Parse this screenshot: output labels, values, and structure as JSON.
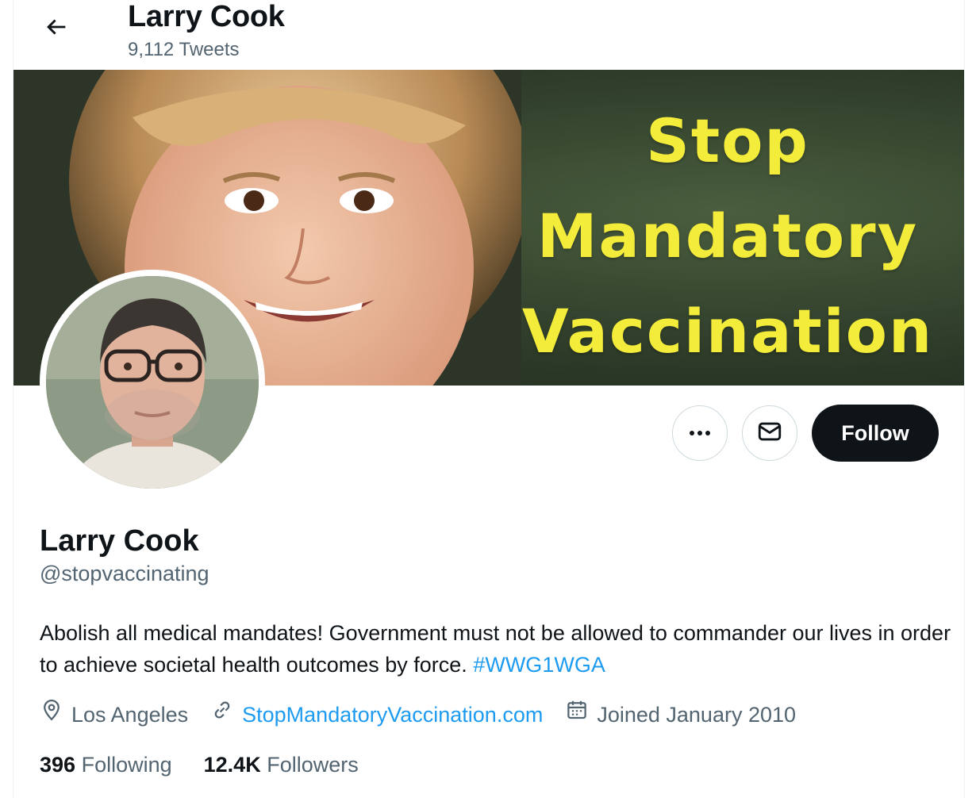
{
  "header": {
    "title": "Larry Cook",
    "tweet_count": "9,112 Tweets"
  },
  "banner": {
    "lines": [
      "Stop",
      "Mandatory",
      "Vaccination"
    ]
  },
  "actions": {
    "more_icon": "ellipsis-icon",
    "message_icon": "mail-icon",
    "follow_label": "Follow"
  },
  "profile": {
    "display_name": "Larry Cook",
    "handle": "@stopvaccinating",
    "bio": "Abolish all medical mandates! Government must not be allowed to commander our lives in order to achieve societal health outcomes by force.",
    "bio_hashtag": "#WWG1WGA",
    "location": "Los Angeles",
    "website": "StopMandatoryVaccination.com",
    "joined": "Joined January 2010"
  },
  "stats": {
    "following_count": "396",
    "following_label": "Following",
    "followers_count": "12.4K",
    "followers_label": "Followers"
  },
  "colors": {
    "accent": "#1d9bf0",
    "banner_text": "#f4ec3a",
    "follow_button": "#0f1419"
  }
}
